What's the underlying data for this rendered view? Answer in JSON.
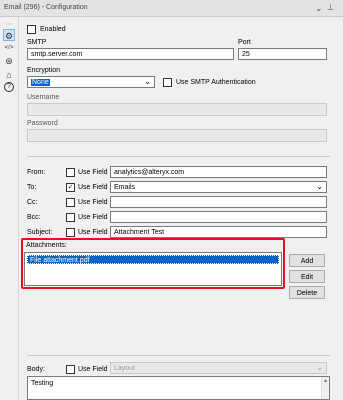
{
  "window": {
    "title": "Email (296) - Configuration",
    "chevron_glyph": "⌄",
    "pin_glyph": "📌"
  },
  "sidebar_icons": [
    {
      "name": "settings-gear-icon",
      "glyph": "⚙",
      "active": true
    },
    {
      "name": "code-brackets-icon",
      "glyph": "</>"
    },
    {
      "name": "transform-icon",
      "glyph": "⊛"
    },
    {
      "name": "tag-icon",
      "glyph": "⌂"
    },
    {
      "name": "help-icon",
      "glyph": "?"
    }
  ],
  "form": {
    "enabled_label": "Enabled",
    "enabled_checked": false,
    "smtp_label": "SMTP",
    "smtp_value": "smtp.server.com",
    "port_label": "Port",
    "port_value": "25",
    "encryption_label": "Encryption",
    "encryption_value": "None",
    "use_smtp_auth_label": "Use SMTP Authentication",
    "use_smtp_auth_checked": false,
    "username_label": "Username",
    "username_value": "",
    "password_label": "Password",
    "password_value": ""
  },
  "fields": {
    "use_field_label": "Use Field",
    "from": {
      "label": "From:",
      "use_field": false,
      "value": "analytics@alteryx.com"
    },
    "to": {
      "label": "To:",
      "use_field": true,
      "value": "Emails"
    },
    "cc": {
      "label": "Cc:",
      "use_field": false,
      "value": ""
    },
    "bcc": {
      "label": "Bcc:",
      "use_field": false,
      "value": ""
    },
    "subject": {
      "label": "Subject:",
      "use_field": false,
      "value": "Attachment Test"
    }
  },
  "attachments": {
    "label": "Attachments:",
    "items": [
      "File attachment.pdf"
    ],
    "add_label": "Add",
    "edit_label": "Edit",
    "delete_label": "Delete"
  },
  "body": {
    "label": "Body:",
    "use_field": false,
    "use_field_label": "Use Field",
    "layout_placeholder": "Layout",
    "text": "Testing"
  },
  "colors": {
    "highlight_border": "#e0141e",
    "selection": "#0a64c8"
  }
}
